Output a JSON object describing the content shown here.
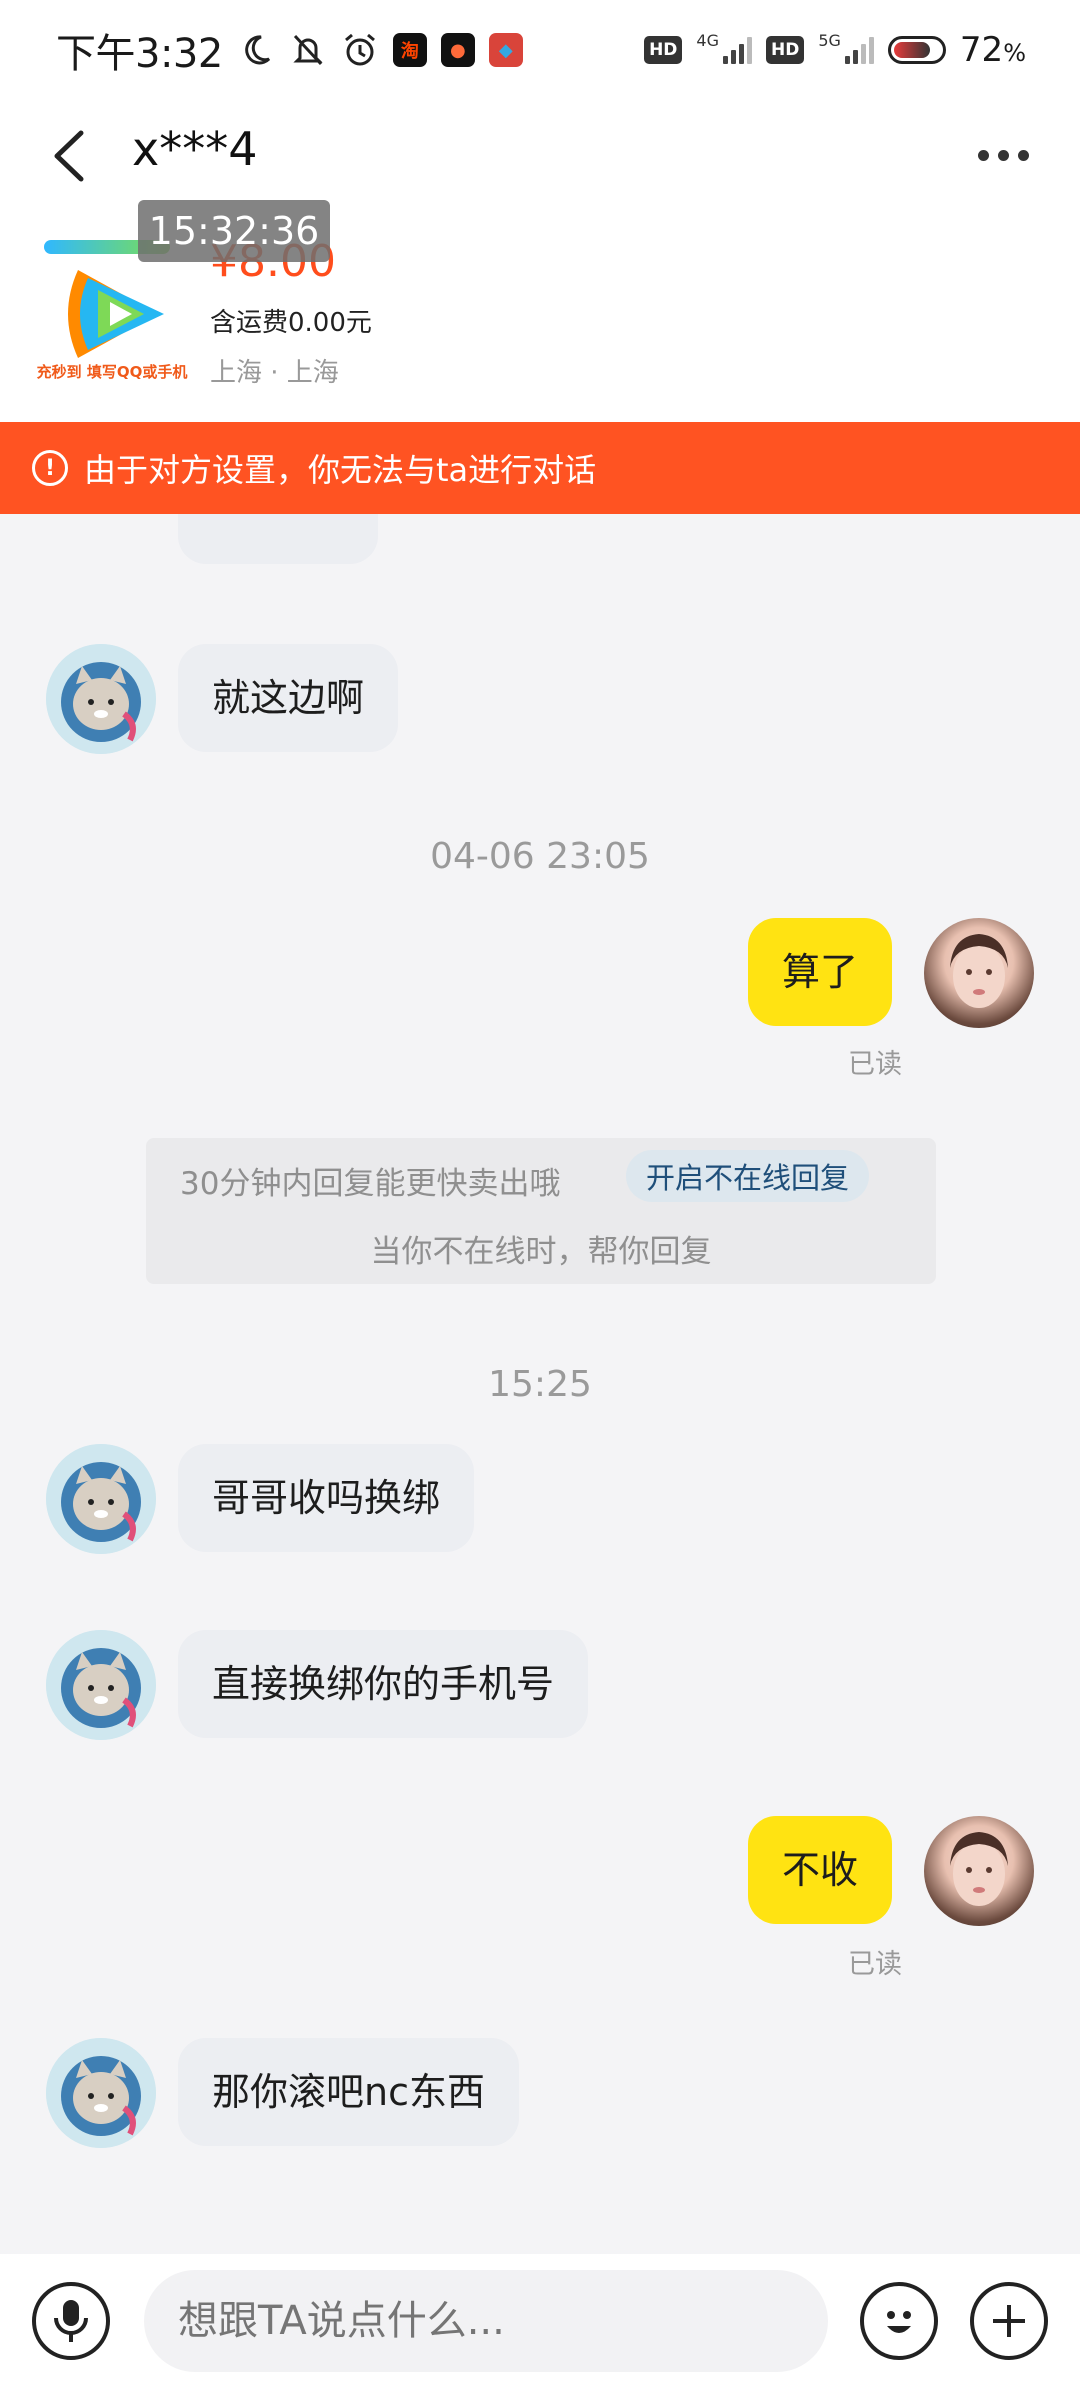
{
  "status_bar": {
    "time": "下午3:32",
    "app_icons": [
      "淘",
      "●",
      "◆"
    ],
    "hd1": "HD",
    "net1": "4G",
    "hd2": "HD",
    "net2": "5G",
    "battery": "72",
    "battery_unit": "%"
  },
  "header": {
    "title": "x***4"
  },
  "product": {
    "price": "¥8.00",
    "shipping": "含运费0.00元",
    "location": "上海 · 上海",
    "thumb_caption": "充秒到 填写QQ或手机",
    "time_overlay": "15:32:36"
  },
  "warning": {
    "text": "由于对方设置，你无法与ta进行对话"
  },
  "messages": [
    {
      "side": "in",
      "text": "就这边啊"
    },
    {
      "timestamp": "04-06 23:05"
    },
    {
      "side": "out",
      "text": "算了",
      "status": "已读"
    },
    {
      "notice": {
        "line1": "30分钟内回复能更快卖出哦",
        "button": "开启不在线回复",
        "line2": "当你不在线时，帮你回复"
      }
    },
    {
      "timestamp": "15:25"
    },
    {
      "side": "in",
      "text": "哥哥收吗换绑"
    },
    {
      "side": "in",
      "text": "直接换绑你的手机号"
    },
    {
      "side": "out",
      "text": "不收",
      "status": "已读"
    },
    {
      "side": "in",
      "text": "那你滚吧nc东西"
    }
  ],
  "input": {
    "placeholder": "想跟TA说点什么..."
  },
  "colors": {
    "accent_yellow": "#ffe312",
    "warning_orange": "#ff5322",
    "price_red": "#ff4d1c"
  },
  "icons": [
    "back-arrow-icon",
    "more-dots-icon",
    "microphone-icon",
    "emoji-icon",
    "plus-icon",
    "warning-icon",
    "moon-icon",
    "mute-bell-icon",
    "alarm-icon",
    "battery-icon",
    "signal-icon"
  ]
}
